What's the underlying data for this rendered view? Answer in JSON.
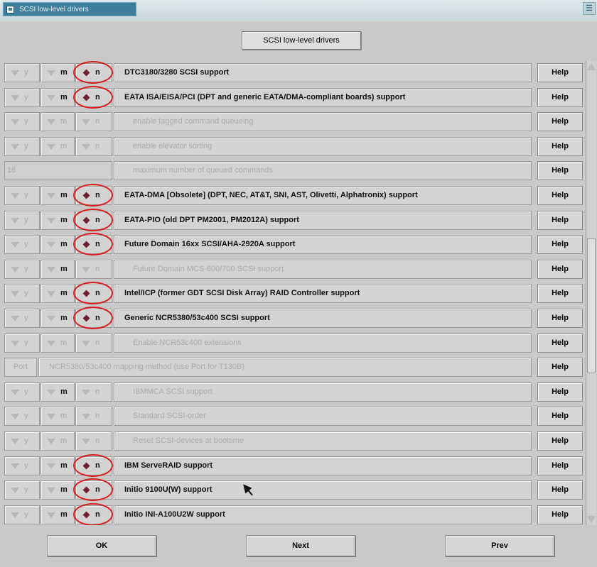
{
  "window": {
    "title": "SCSI low-level drivers",
    "maximize_glyph": "☰"
  },
  "header": {
    "button_label": "SCSI low-level drivers"
  },
  "tristate": {
    "y": "y",
    "m": "m",
    "n": "n"
  },
  "rows": [
    {
      "kind": "tri",
      "label": "DTC3180/3280 SCSI support",
      "enabled": true,
      "m_enabled": true,
      "selected": "n",
      "circled": true
    },
    {
      "kind": "tri",
      "label": "EATA ISA/EISA/PCI (DPT and generic EATA/DMA-compliant boards) support",
      "enabled": true,
      "m_enabled": true,
      "selected": "n",
      "circled": true
    },
    {
      "kind": "tri",
      "label": "enable tagged command queueing",
      "enabled": false,
      "m_enabled": false,
      "selected": "",
      "circled": false
    },
    {
      "kind": "tri",
      "label": "enable elevator sorting",
      "enabled": false,
      "m_enabled": false,
      "selected": "",
      "circled": false
    },
    {
      "kind": "int",
      "value": "16",
      "label": "maximum number of queued commands",
      "enabled": false
    },
    {
      "kind": "tri",
      "label": "EATA-DMA [Obsolete] (DPT, NEC, AT&T, SNI, AST, Olivetti, Alphatronix) support",
      "enabled": true,
      "m_enabled": true,
      "selected": "n",
      "circled": true
    },
    {
      "kind": "tri",
      "label": "EATA-PIO (old DPT PM2001, PM2012A) support",
      "enabled": true,
      "m_enabled": true,
      "selected": "n",
      "circled": true
    },
    {
      "kind": "tri",
      "label": "Future Domain 16xx SCSI/AHA-2920A support",
      "enabled": true,
      "m_enabled": true,
      "selected": "n",
      "circled": true
    },
    {
      "kind": "tri",
      "label": "Future Domain MCS-600/700 SCSI support",
      "enabled": false,
      "m_enabled": true,
      "selected": "",
      "circled": false
    },
    {
      "kind": "tri",
      "label": "Intel/ICP (former GDT SCSI Disk Array) RAID Controller support",
      "enabled": true,
      "m_enabled": true,
      "selected": "n",
      "circled": true
    },
    {
      "kind": "tri",
      "label": "Generic NCR5380/53c400 SCSI support",
      "enabled": true,
      "m_enabled": true,
      "selected": "n",
      "circled": true
    },
    {
      "kind": "tri",
      "label": "Enable NCR53c400 extensions",
      "enabled": false,
      "m_enabled": false,
      "selected": "",
      "circled": false
    },
    {
      "kind": "choice",
      "button": "Port",
      "label": "NCR5380/53c400 mapping method (use Port for T130B)",
      "enabled": false
    },
    {
      "kind": "tri",
      "label": "IBMMCA SCSI support",
      "enabled": false,
      "m_enabled": true,
      "selected": "",
      "circled": false
    },
    {
      "kind": "tri",
      "label": "Standard SCSI-order",
      "enabled": false,
      "m_enabled": false,
      "selected": "",
      "circled": false
    },
    {
      "kind": "tri",
      "label": "Reset SCSI-devices at boottime",
      "enabled": false,
      "m_enabled": false,
      "selected": "",
      "circled": false
    },
    {
      "kind": "tri",
      "label": "IBM ServeRAID support",
      "enabled": true,
      "m_enabled": true,
      "selected": "n",
      "circled": true
    },
    {
      "kind": "tri",
      "label": "Initio 9100U(W) support",
      "enabled": true,
      "m_enabled": true,
      "selected": "n",
      "circled": true
    },
    {
      "kind": "tri",
      "label": "Initio INI-A100U2W support",
      "enabled": true,
      "m_enabled": true,
      "selected": "n",
      "circled": true
    }
  ],
  "help_label": "Help",
  "footer": {
    "ok_label": "OK",
    "next_label": "Next",
    "prev_label": "Prev"
  },
  "colors": {
    "annotation_circle": "#d81d1d",
    "selected_diamond": "#6e2030",
    "title_bar": "#3e7f9c"
  }
}
